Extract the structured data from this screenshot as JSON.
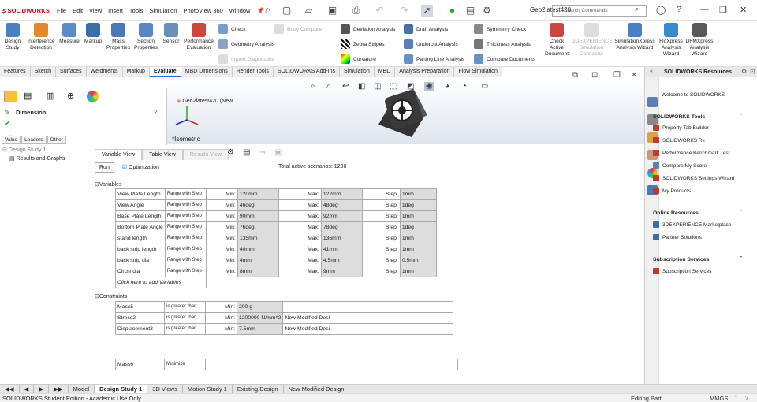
{
  "app": {
    "logo": "SOLIDWORKS",
    "doc_title": "Geo2latest420"
  },
  "menu": [
    "File",
    "Edit",
    "View",
    "Insert",
    "Tools",
    "Simulation",
    "PhotoView 360",
    "Window"
  ],
  "search": {
    "placeholder": "Search Commands"
  },
  "ribbon": {
    "big": [
      "Design Study",
      "Interference Detection",
      "Measure",
      "Markup",
      "Mass Properties",
      "Section Properties",
      "Sensor",
      "Performance Evaluation"
    ],
    "col1": [
      "Check",
      "Geometry Analysis",
      "Import Diagnostics"
    ],
    "col1b": "Body Compare",
    "col2": [
      "Deviation Analysis",
      "Zebra Stripes",
      "Curvature"
    ],
    "col3": [
      "Draft Analysis",
      "Undercut Analysis",
      "Parting Line Analysis"
    ],
    "col4": [
      "Symmetry Check",
      "Thickness Analysis",
      "Compare Documents"
    ],
    "big2": [
      "Check Active Document",
      "3DEXPERIENCE Simulation Connector",
      "SimulationXpress Analysis Wizard",
      "FloXpress Analysis Wizard",
      "DFMXpress Analysis Wizard"
    ]
  },
  "tabs": [
    "Features",
    "Sketch",
    "Surfaces",
    "Weldments",
    "Markup",
    "Evaluate",
    "MBD Dimensions",
    "Render Tools",
    "SOLIDWORKS Add-Ins",
    "Simulation",
    "MBD",
    "Analysis Preparation",
    "Flow Simulation"
  ],
  "active_tab": "Evaluate",
  "viewport": {
    "tree_node": "Geo2latest420 (New...",
    "view_label": "*Isometric"
  },
  "fm": {
    "title": "Dimension",
    "tabs": [
      "Value",
      "Leaders",
      "Other"
    ]
  },
  "tree": {
    "root": "Design Study 1",
    "child": "Results and Graphs"
  },
  "study": {
    "subtabs": [
      "Variable View",
      "Table View",
      "Results View"
    ],
    "run": "Run",
    "optimization": "Optimization",
    "scenarios": "Total active scenarios:  1296",
    "variables_label": "Variables",
    "min_label": "Min:",
    "max_label": "Max:",
    "step_label": "Step:",
    "range_label": "Range with Step",
    "variables": [
      {
        "name": "View Plate Length",
        "min": "120mm",
        "max": "122mm",
        "step": "1mm"
      },
      {
        "name": "View Angle",
        "min": "46deg",
        "max": "48deg",
        "step": "1deg"
      },
      {
        "name": "Base Plate Length",
        "min": "90mm",
        "max": "92mm",
        "step": "1mm"
      },
      {
        "name": "Bottom Plate Angle",
        "min": "76deg",
        "max": "78deg",
        "step": "1deg"
      },
      {
        "name": "stand length",
        "min": "135mm",
        "max": "136mm",
        "step": "1mm"
      },
      {
        "name": "back strip length",
        "min": "40mm",
        "max": "41mm",
        "step": "1mm"
      },
      {
        "name": "back strip dia",
        "min": "4mm",
        "max": "4.5mm",
        "step": "0.5mm"
      },
      {
        "name": "Circle dia",
        "min": "8mm",
        "max": "9mm",
        "step": "1mm"
      }
    ],
    "add_variables": "Click here to add Variables",
    "constraints_label": "Constraints",
    "constraints": [
      {
        "name": "Mass5",
        "cond": "is greater than",
        "min": "200 g",
        "study": ""
      },
      {
        "name": "Stress2",
        "cond": "is greater than",
        "min": "1200000 N/mm^2",
        "study": "New Modified Desi"
      },
      {
        "name": "Displacement3",
        "cond": "is greater than",
        "min": "7.5mm",
        "study": "New Modified Desi"
      }
    ],
    "goal": {
      "name": "Mass6",
      "cond": "Minimize"
    }
  },
  "resources": {
    "title": "SOLIDWORKS Resources",
    "welcome": "Welcome to SOLIDWORKS",
    "tools_label": "SOLIDWORKS Tools",
    "tools": [
      "Property Tab Builder",
      "SOLIDWORKS Rx",
      "Performance Benchmark Test",
      "Compare My Score",
      "SOLIDWORKS Settings Wizard",
      "My Products"
    ],
    "online_label": "Online Resources",
    "online": [
      "3DEXPERIENCE Marketplace",
      "Partner Solutions"
    ],
    "sub_label": "Subscription Services",
    "sub": [
      "Subscription Services"
    ]
  },
  "bottom_tabs": [
    "Model",
    "Design Study 1",
    "3D Views",
    "Motion Study 1",
    "Existing Design",
    "New Modified Design"
  ],
  "status": {
    "left": "SOLIDWORKS Student Edition - Academic Use Only",
    "mode": "Editing Part",
    "units": "MMGS"
  }
}
